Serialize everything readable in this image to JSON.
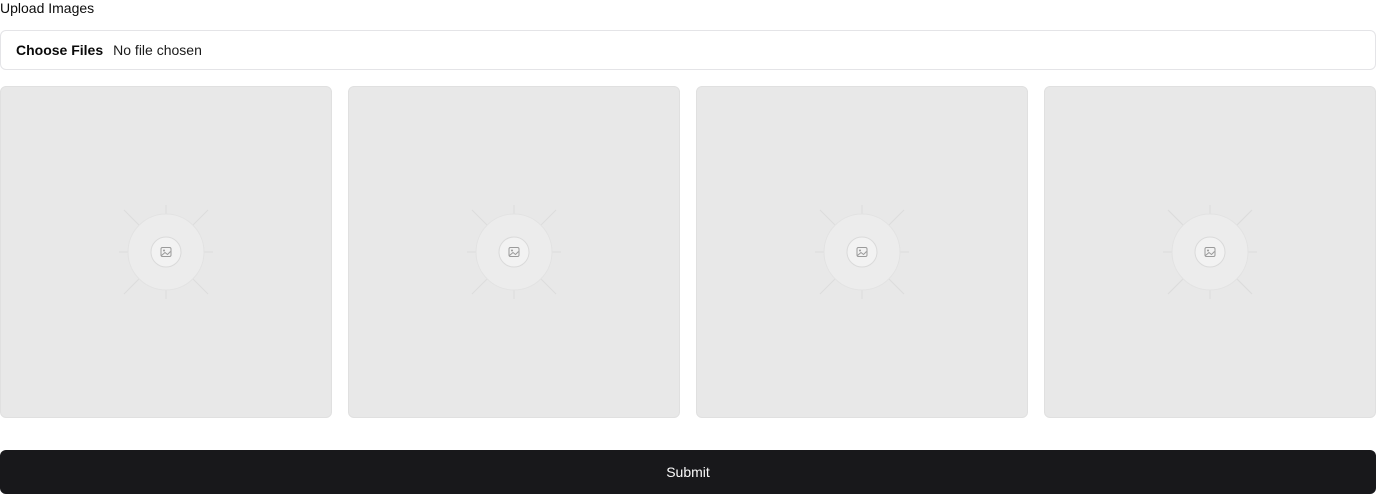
{
  "upload": {
    "label": "Upload Images",
    "choose_label": "Choose Files",
    "status": "No file chosen"
  },
  "gallery": {
    "placeholder_icon": "image-placeholder-icon",
    "tile_count": 4
  },
  "submit": {
    "label": "Submit"
  },
  "colors": {
    "tile_bg": "#e8e8e8",
    "submit_bg": "#18181b",
    "submit_text": "#fafafa",
    "input_border": "#e4e4e7"
  }
}
